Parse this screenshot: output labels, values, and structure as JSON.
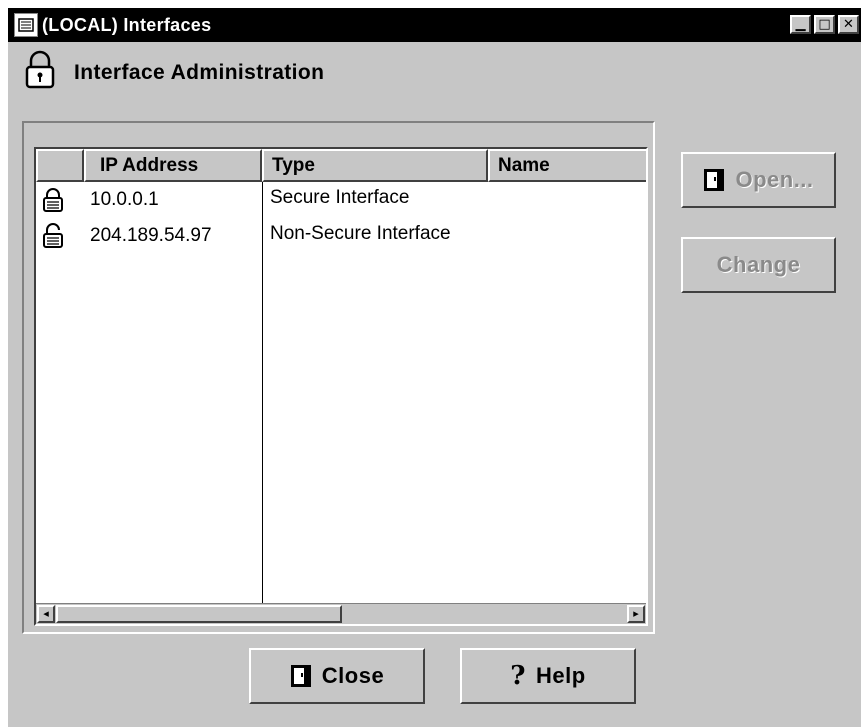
{
  "window": {
    "title": "(LOCAL) Interfaces",
    "controls": {
      "minimize": "▁",
      "maximize": "□",
      "close": "✕"
    }
  },
  "header": {
    "title": "Interface Administration",
    "icon": "padlock-icon"
  },
  "table": {
    "columns": [
      "",
      "IP Address",
      "Type",
      "Name"
    ],
    "rows": [
      {
        "lock": "locked-padlock-icon",
        "ip": "10.0.0.1",
        "type": "Secure Interface",
        "name": ""
      },
      {
        "lock": "unlocked-padlock-icon",
        "ip": "204.189.54.97",
        "type": "Non-Secure Interface",
        "name": ""
      }
    ],
    "scroll": {
      "left_arrow": "◂",
      "right_arrow": "▸"
    }
  },
  "side_buttons": {
    "open_label": "Open...",
    "change_label": "Change"
  },
  "bottom_buttons": {
    "close_label": "Close",
    "help_label": "Help",
    "help_icon_glyph": "?"
  },
  "colors": {
    "face": "#c6c6c6",
    "titlebar": "#000000",
    "disabled_text": "#8a8a8a"
  }
}
